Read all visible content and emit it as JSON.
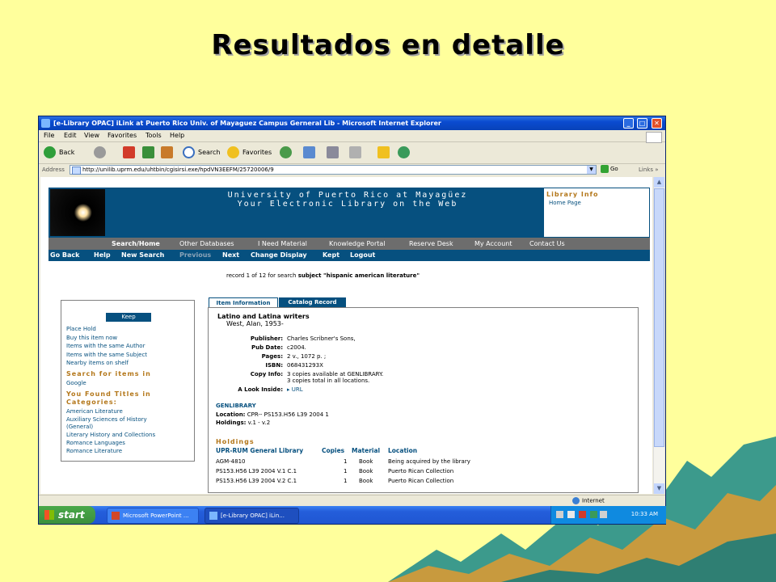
{
  "slide_title": "Resultados en detalle",
  "window": {
    "title": "[e-Library OPAC] iLink at Puerto Rico Univ. of Mayaguez Campus Gerneral Lib - Microsoft Internet Explorer",
    "menu": [
      "File",
      "Edit",
      "View",
      "Favorites",
      "Tools",
      "Help"
    ],
    "toolbar": {
      "back": "Back",
      "search": "Search",
      "favorites": "Favorites"
    },
    "address_label": "Address",
    "url": "http://unilib.uprm.edu/uhtbin/cgisirsi.exe/hpdVN3EEFM/25720006/9",
    "go": "Go",
    "links": "Links",
    "status_zone": "Internet"
  },
  "taskbar": {
    "start": "start",
    "tasks": [
      "Microsoft PowerPoint ...",
      "[e-Library OPAC] iLin..."
    ],
    "clock": "10:33 AM"
  },
  "library": {
    "title1": "University of Puerto Rico at Mayagüez",
    "title2": "Your Electronic Library on the Web",
    "info_title": "Library Info",
    "info_link": "Home Page",
    "nav1": [
      "Search/Home",
      "Other Databases",
      "I Need Material",
      "Knowledge Portal",
      "Reserve Desk",
      "My Account",
      "Contact Us"
    ],
    "nav2": [
      "Go Back",
      "Help",
      "New Search",
      "Previous",
      "Next",
      "Change Display",
      "Kept",
      "Logout"
    ]
  },
  "record": {
    "prefix": "record 1 of 12 for search ",
    "query": "subject \"hispanic american literature\""
  },
  "sidebar": {
    "keep": "Keep",
    "links": [
      "Place Hold",
      "Buy this item now",
      "Items with the same Author",
      "Items with the same Subject",
      "Nearby items on shelf"
    ],
    "search_head": "Search for items in",
    "search_links": [
      "Google"
    ],
    "found_head1": "You Found Titles in",
    "found_head2": "Categories:",
    "categories": [
      "American Literature",
      "Auxiliary Sciences of History",
      "(General)",
      "Literary History and Collections",
      "Romance Languages",
      "Romance Literature"
    ]
  },
  "tabs": {
    "item_info": "Item Information",
    "catalog": "Catalog Record"
  },
  "item": {
    "title": "Latino and Latina writers",
    "author": "West, Alan, 1953-",
    "fields": [
      {
        "label": "Publisher:",
        "value": "Charles Scribner's Sons,"
      },
      {
        "label": "Pub Date:",
        "value": "c2004."
      },
      {
        "label": "Pages:",
        "value": "2 v., 1072 p. ;"
      },
      {
        "label": "ISBN:",
        "value": "068431293X"
      },
      {
        "label": "Copy Info:",
        "value": "3 copies available at GENLIBRARY."
      },
      {
        "label": "",
        "value": "3 copies total in all locations."
      },
      {
        "label": "A Look Inside:",
        "value": "URL"
      }
    ],
    "genlibrary_head": "GENLIBRARY",
    "location_label": "Location:",
    "location_value": "CPR-- PS153.H56 L39 2004 1",
    "holdings_label": "Holdings:",
    "holdings_value": "v.1 - v.2"
  },
  "holdings": {
    "head": "Holdings",
    "columns": [
      "UPR-RUM General Library",
      "Copies",
      "Material",
      "Location"
    ],
    "rows": [
      [
        "AGM-4810",
        "1",
        "Book",
        "Being acquired by the library"
      ],
      [
        "PS153.H56 L39 2004 V.1 C.1",
        "1",
        "Book",
        "Puerto Rican Collection"
      ],
      [
        "PS153.H56 L39 2004 V.2 C.1",
        "1",
        "Book",
        "Puerto Rican Collection"
      ]
    ]
  }
}
